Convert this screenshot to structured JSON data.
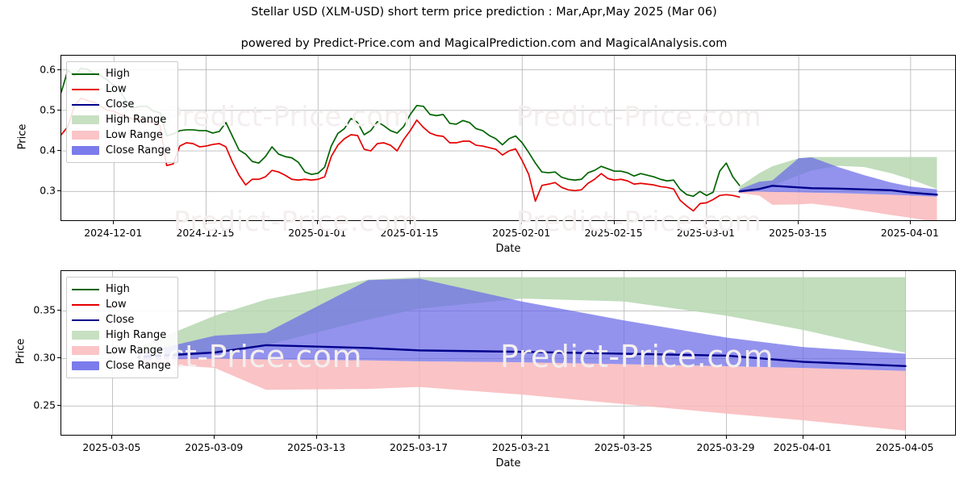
{
  "header": {
    "title": "Stellar USD (XLM-USD) short term price prediction : Mar,Apr,May 2025 (Mar 06)",
    "subtitle": "powered by Predict-Price.com and MagicalPrediction.com and MagicalAnalysis.com"
  },
  "watermark": {
    "text": "Predict-Price.com"
  },
  "colors": {
    "high": "#006400",
    "low": "#e60000",
    "close": "#00008b",
    "high_range": "#b6d7b0",
    "low_range": "#f9b8bb",
    "close_range": "#6a6ae8",
    "grid": "#b0b0b0",
    "axis": "#000000"
  },
  "legend": {
    "entries": [
      {
        "label": "High",
        "kind": "line",
        "color": "#006400"
      },
      {
        "label": "Low",
        "kind": "line",
        "color": "#e60000"
      },
      {
        "label": "Close",
        "kind": "line",
        "color": "#00008b"
      },
      {
        "label": "High Range",
        "kind": "patch",
        "color": "#c8e0c2"
      },
      {
        "label": "Low Range",
        "kind": "patch",
        "color": "#fbc4c7"
      },
      {
        "label": "Close Range",
        "kind": "patch",
        "color": "#7b7bec"
      }
    ]
  },
  "chart_data": [
    {
      "id": "top",
      "type": "line",
      "title": "Stellar USD (XLM-USD) short term price prediction : Mar,Apr,May 2025 (Mar 06)",
      "subtitle": "powered by Predict-Price.com and MagicalPrediction.com and MagicalAnalysis.com",
      "xlabel": "Date",
      "ylabel": "Price",
      "grid": true,
      "legend_position": "upper left",
      "ylim": [
        0.225,
        0.635
      ],
      "yticks": [
        0.3,
        0.4,
        0.5,
        0.6
      ],
      "ytick_labels": [
        "0.3",
        "0.4",
        "0.5",
        "0.6"
      ],
      "xlim": [
        "2024-11-23",
        "2025-04-08"
      ],
      "xticks": [
        "2024-12-01",
        "2024-12-15",
        "2025-01-01",
        "2025-01-15",
        "2025-02-01",
        "2025-02-15",
        "2025-03-01",
        "2025-03-15",
        "2025-04-01"
      ],
      "history": {
        "dates": [
          "2024-11-23",
          "2024-11-24",
          "2024-11-25",
          "2024-11-26",
          "2024-11-27",
          "2024-11-28",
          "2024-11-29",
          "2024-11-30",
          "2024-12-01",
          "2024-12-02",
          "2024-12-03",
          "2024-12-04",
          "2024-12-05",
          "2024-12-06",
          "2024-12-07",
          "2024-12-08",
          "2024-12-09",
          "2024-12-10",
          "2024-12-11",
          "2024-12-12",
          "2024-12-13",
          "2024-12-14",
          "2024-12-15",
          "2024-12-16",
          "2024-12-17",
          "2024-12-18",
          "2024-12-19",
          "2024-12-20",
          "2024-12-21",
          "2024-12-22",
          "2024-12-23",
          "2024-12-24",
          "2024-12-25",
          "2024-12-26",
          "2024-12-27",
          "2024-12-28",
          "2024-12-29",
          "2024-12-30",
          "2024-12-31",
          "2025-01-01",
          "2025-01-02",
          "2025-01-03",
          "2025-01-04",
          "2025-01-05",
          "2025-01-06",
          "2025-01-07",
          "2025-01-08",
          "2025-01-09",
          "2025-01-10",
          "2025-01-11",
          "2025-01-12",
          "2025-01-13",
          "2025-01-14",
          "2025-01-15",
          "2025-01-16",
          "2025-01-17",
          "2025-01-18",
          "2025-01-19",
          "2025-01-20",
          "2025-01-21",
          "2025-01-22",
          "2025-01-23",
          "2025-01-24",
          "2025-01-25",
          "2025-01-26",
          "2025-01-27",
          "2025-01-28",
          "2025-01-29",
          "2025-01-30",
          "2025-01-31",
          "2025-02-01",
          "2025-02-02",
          "2025-02-03",
          "2025-02-04",
          "2025-02-05",
          "2025-02-06",
          "2025-02-07",
          "2025-02-08",
          "2025-02-09",
          "2025-02-10",
          "2025-02-11",
          "2025-02-12",
          "2025-02-13",
          "2025-02-14",
          "2025-02-15",
          "2025-02-16",
          "2025-02-17",
          "2025-02-18",
          "2025-02-19",
          "2025-02-20",
          "2025-02-21",
          "2025-02-22",
          "2025-02-23",
          "2025-02-24",
          "2025-02-25",
          "2025-02-26",
          "2025-02-27",
          "2025-02-28",
          "2025-03-01",
          "2025-03-02",
          "2025-03-03",
          "2025-03-04",
          "2025-03-05",
          "2025-03-06"
        ],
        "high": [
          0.545,
          0.6,
          0.585,
          0.604,
          0.601,
          0.59,
          0.585,
          0.575,
          0.56,
          0.545,
          0.52,
          0.506,
          0.51,
          0.51,
          0.498,
          0.494,
          0.437,
          0.442,
          0.45,
          0.452,
          0.452,
          0.45,
          0.45,
          0.444,
          0.448,
          0.47,
          0.436,
          0.402,
          0.392,
          0.374,
          0.37,
          0.386,
          0.41,
          0.392,
          0.386,
          0.383,
          0.372,
          0.348,
          0.342,
          0.345,
          0.36,
          0.412,
          0.443,
          0.455,
          0.48,
          0.47,
          0.44,
          0.45,
          0.472,
          0.462,
          0.45,
          0.444,
          0.46,
          0.49,
          0.512,
          0.51,
          0.49,
          0.487,
          0.49,
          0.468,
          0.466,
          0.475,
          0.47,
          0.455,
          0.45,
          0.438,
          0.43,
          0.415,
          0.43,
          0.437,
          0.42,
          0.396,
          0.37,
          0.348,
          0.346,
          0.348,
          0.335,
          0.33,
          0.328,
          0.33,
          0.346,
          0.352,
          0.362,
          0.356,
          0.35,
          0.35,
          0.346,
          0.338,
          0.344,
          0.34,
          0.336,
          0.33,
          0.326,
          0.328,
          0.305,
          0.292,
          0.288,
          0.3,
          0.29,
          0.298,
          0.35,
          0.37,
          0.336,
          0.315,
          0.302,
          0.302
        ],
        "low": [
          0.44,
          0.46,
          0.512,
          0.53,
          0.524,
          0.52,
          0.51,
          0.5,
          0.498,
          0.49,
          0.484,
          0.478,
          0.478,
          0.472,
          0.47,
          0.462,
          0.364,
          0.368,
          0.412,
          0.42,
          0.418,
          0.41,
          0.412,
          0.416,
          0.418,
          0.41,
          0.372,
          0.34,
          0.316,
          0.33,
          0.33,
          0.336,
          0.352,
          0.348,
          0.34,
          0.33,
          0.328,
          0.33,
          0.328,
          0.33,
          0.336,
          0.386,
          0.414,
          0.43,
          0.44,
          0.438,
          0.404,
          0.4,
          0.418,
          0.42,
          0.414,
          0.4,
          0.428,
          0.45,
          0.476,
          0.458,
          0.444,
          0.438,
          0.436,
          0.42,
          0.42,
          0.424,
          0.424,
          0.414,
          0.412,
          0.408,
          0.404,
          0.39,
          0.4,
          0.405,
          0.376,
          0.342,
          0.276,
          0.315,
          0.318,
          0.322,
          0.31,
          0.304,
          0.302,
          0.304,
          0.32,
          0.33,
          0.344,
          0.332,
          0.328,
          0.33,
          0.326,
          0.318,
          0.32,
          0.318,
          0.316,
          0.312,
          0.31,
          0.306,
          0.278,
          0.264,
          0.252,
          0.27,
          0.272,
          0.28,
          0.29,
          0.292,
          0.29,
          0.286,
          0.29,
          0.296
        ]
      },
      "forecast": {
        "dates": [
          "2025-03-06",
          "2025-03-09",
          "2025-03-11",
          "2025-03-15",
          "2025-03-17",
          "2025-03-21",
          "2025-03-25",
          "2025-03-29",
          "2025-04-01",
          "2025-04-05"
        ],
        "close": [
          0.3,
          0.306,
          0.314,
          0.31,
          0.308,
          0.307,
          0.305,
          0.303,
          0.297,
          0.292
        ],
        "high_range_upper": [
          0.312,
          0.345,
          0.362,
          0.382,
          0.385,
          0.385,
          0.385,
          0.385,
          0.385,
          0.385
        ],
        "high_range_lower": [
          0.3,
          0.306,
          0.314,
          0.34,
          0.352,
          0.363,
          0.36,
          0.345,
          0.33,
          0.306
        ],
        "low_range_upper": [
          0.3,
          0.3,
          0.299,
          0.298,
          0.297,
          0.296,
          0.294,
          0.292,
          0.29,
          0.287
        ],
        "low_range_lower": [
          0.296,
          0.29,
          0.267,
          0.268,
          0.27,
          0.262,
          0.252,
          0.242,
          0.235,
          0.224
        ],
        "close_range_upper": [
          0.305,
          0.324,
          0.327,
          0.382,
          0.384,
          0.36,
          0.34,
          0.322,
          0.312,
          0.305
        ],
        "close_range_lower": [
          0.298,
          0.3,
          0.299,
          0.298,
          0.297,
          0.296,
          0.294,
          0.292,
          0.29,
          0.287
        ]
      }
    },
    {
      "id": "bottom",
      "type": "line",
      "xlabel": "Date",
      "ylabel": "Price",
      "grid": true,
      "legend_position": "upper left",
      "ylim": [
        0.218,
        0.392
      ],
      "yticks": [
        0.25,
        0.3,
        0.35
      ],
      "ytick_labels": [
        "0.25",
        "0.30",
        "0.35"
      ],
      "xlim": [
        "2025-03-03",
        "2025-04-07"
      ],
      "xticks": [
        "2025-03-05",
        "2025-03-09",
        "2025-03-13",
        "2025-03-17",
        "2025-03-21",
        "2025-03-25",
        "2025-03-29",
        "2025-04-01",
        "2025-04-05"
      ],
      "forecast": {
        "dates": [
          "2025-03-06",
          "2025-03-09",
          "2025-03-11",
          "2025-03-15",
          "2025-03-17",
          "2025-03-21",
          "2025-03-25",
          "2025-03-29",
          "2025-04-01",
          "2025-04-05"
        ],
        "close": [
          0.3015,
          0.3063,
          0.314,
          0.311,
          0.3085,
          0.307,
          0.305,
          0.303,
          0.2965,
          0.292
        ],
        "high_range_upper": [
          0.312,
          0.345,
          0.362,
          0.383,
          0.3855,
          0.3855,
          0.3855,
          0.3855,
          0.3855,
          0.3855
        ],
        "high_range_lower": [
          0.3015,
          0.3063,
          0.314,
          0.341,
          0.3525,
          0.363,
          0.36,
          0.345,
          0.33,
          0.306
        ],
        "low_range_upper": [
          0.3,
          0.3,
          0.299,
          0.298,
          0.297,
          0.296,
          0.294,
          0.292,
          0.29,
          0.287
        ],
        "low_range_lower": [
          0.296,
          0.29,
          0.267,
          0.268,
          0.27,
          0.262,
          0.252,
          0.242,
          0.235,
          0.224
        ],
        "close_range_upper": [
          0.305,
          0.324,
          0.327,
          0.3825,
          0.384,
          0.36,
          0.34,
          0.322,
          0.312,
          0.305
        ],
        "close_range_lower": [
          0.2985,
          0.3,
          0.299,
          0.298,
          0.297,
          0.296,
          0.294,
          0.292,
          0.29,
          0.287
        ]
      }
    }
  ]
}
